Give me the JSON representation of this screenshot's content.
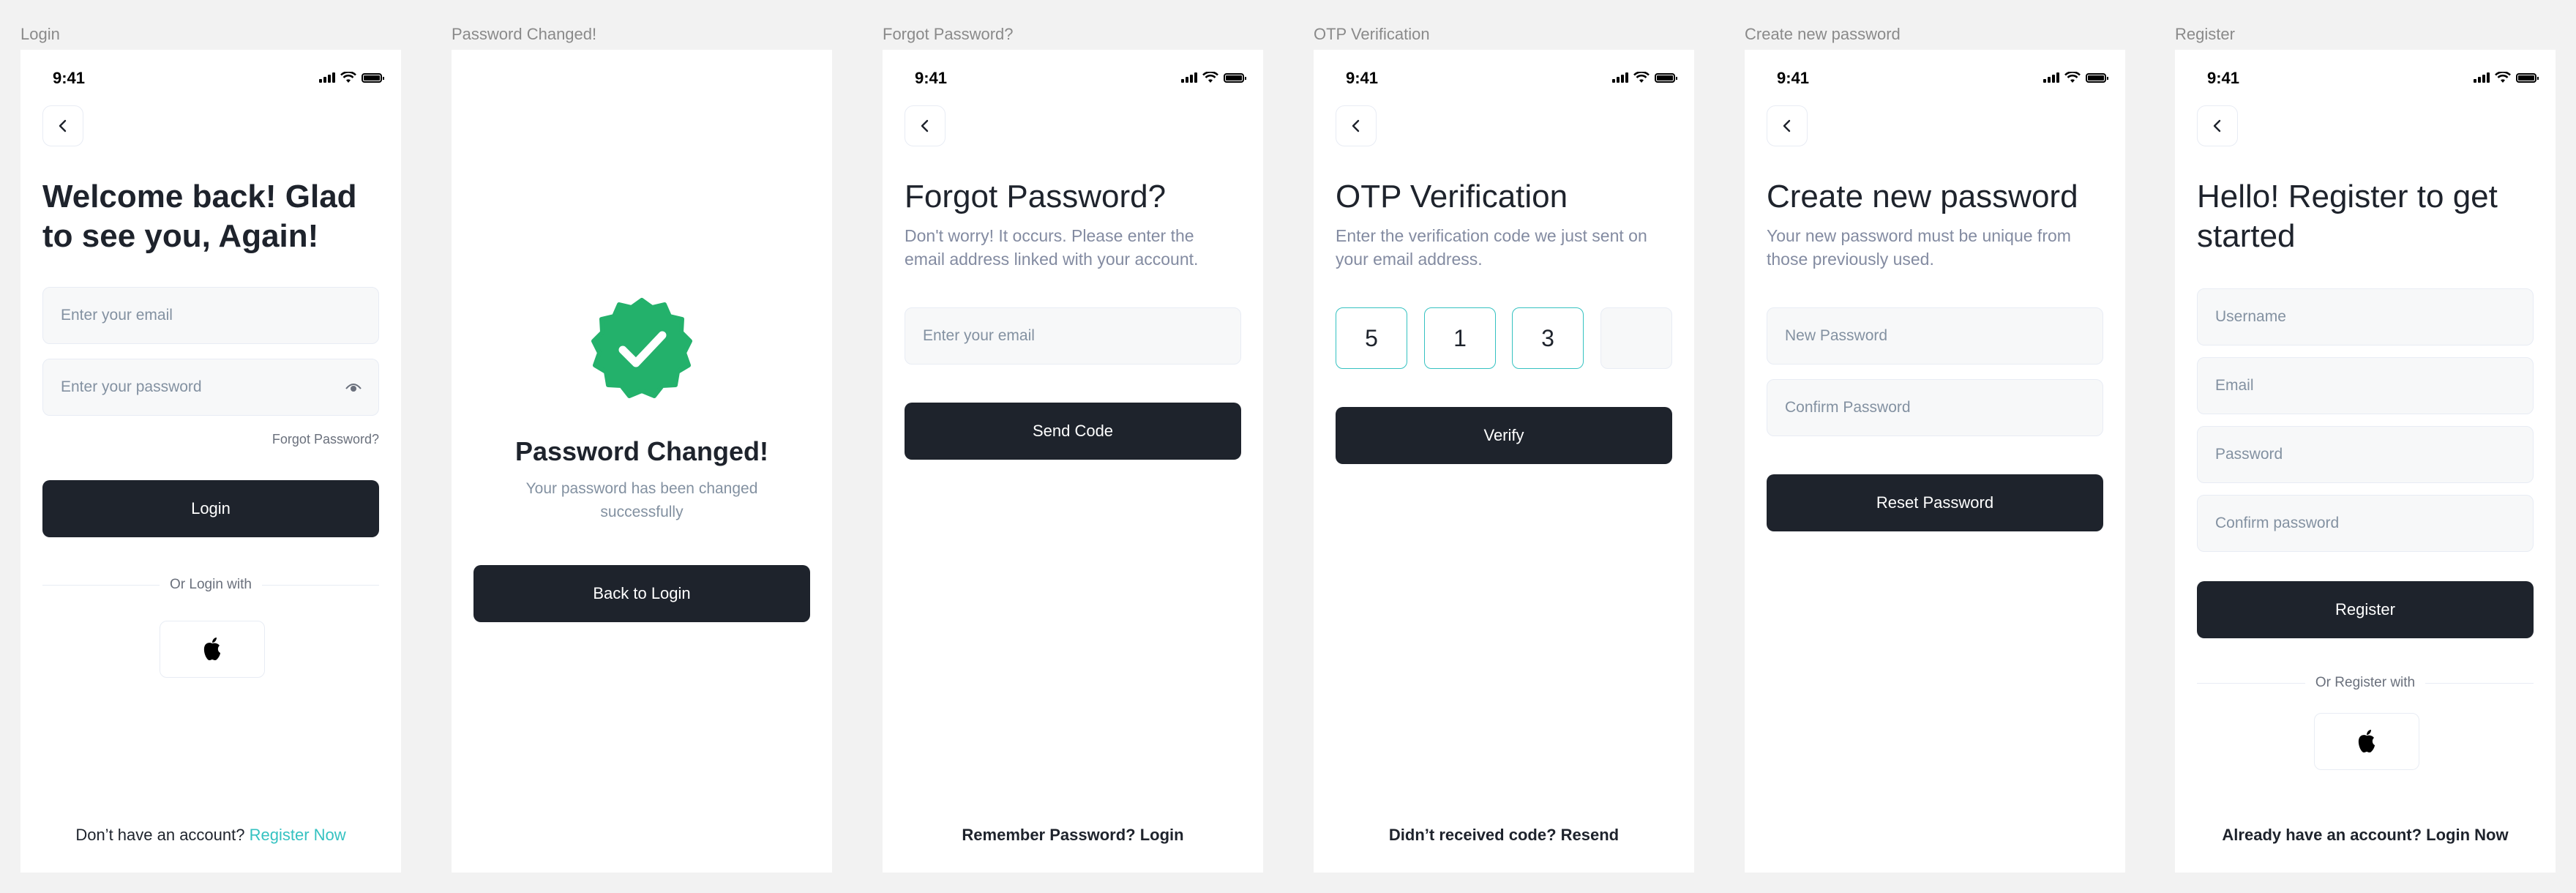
{
  "status": {
    "time": "9:41"
  },
  "frames": {
    "login": {
      "label": "Login",
      "heading_line1": "Welcome back! Glad",
      "heading_line2": "to see you, Again!",
      "email_placeholder": "Enter your email",
      "password_placeholder": "Enter your password",
      "forgot_link": "Forgot Password?",
      "login_button": "Login",
      "divider_text": "Or Login with",
      "bottom_text": "Don’t have an account?",
      "bottom_link": "Register Now"
    },
    "password_changed": {
      "label": "Password Changed!",
      "title": "Password Changed!",
      "subtitle_line1": "Your password has been changed",
      "subtitle_line2": "successfully",
      "back_button": "Back to Login"
    },
    "forgot_password": {
      "label": "Forgot Password?",
      "heading": "Forgot Password?",
      "subtitle_line1": "Don't worry! It occurs. Please enter the",
      "subtitle_line2": "email address linked with your account.",
      "email_placeholder": "Enter your email",
      "send_button": "Send Code",
      "bottom_text": "Remember Password? Login"
    },
    "otp": {
      "label": "OTP Verification",
      "heading": "OTP Verification",
      "subtitle_line1": "Enter the verification code we just sent on",
      "subtitle_line2": "your email address.",
      "digits": [
        "5",
        "1",
        "3",
        ""
      ],
      "verify_button": "Verify",
      "bottom_text": "Didn’t received code? Resend"
    },
    "create_password": {
      "label": "Create new password",
      "heading": "Create new password",
      "subtitle_line1": "Your new password must be unique from",
      "subtitle_line2": "those previously used.",
      "new_password_placeholder": "New Password",
      "confirm_password_placeholder": "Confirm Password",
      "reset_button": "Reset Password"
    },
    "register": {
      "label": "Register",
      "heading_line1": "Hello! Register to get",
      "heading_line2": "started",
      "username_placeholder": "Username",
      "email_placeholder": "Email",
      "password_placeholder": "Password",
      "confirm_placeholder": "Confirm password",
      "register_button": "Register",
      "divider_text": "Or Register with",
      "bottom_text": "Already have an account? Login Now"
    }
  },
  "colors": {
    "accent": "#35c2c1",
    "dark_button": "#1e232c",
    "success_green": "#23b16b"
  }
}
